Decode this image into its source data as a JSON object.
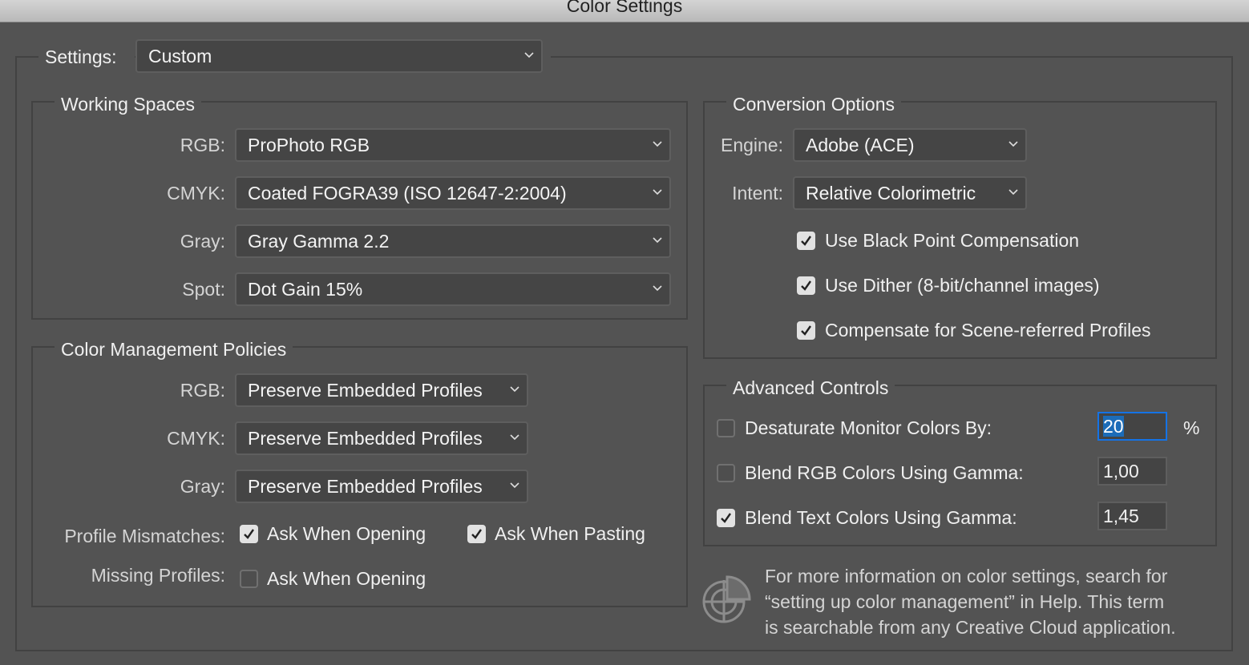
{
  "window": {
    "title": "Color Settings"
  },
  "settings": {
    "label": "Settings:",
    "value": "Custom"
  },
  "working_spaces": {
    "title": "Working Spaces",
    "rows": [
      {
        "label": "RGB:",
        "value": "ProPhoto RGB"
      },
      {
        "label": "CMYK:",
        "value": "Coated FOGRA39 (ISO 12647-2:2004)"
      },
      {
        "label": "Gray:",
        "value": "Gray Gamma 2.2"
      },
      {
        "label": "Spot:",
        "value": "Dot Gain 15%"
      }
    ]
  },
  "policies": {
    "title": "Color Management Policies",
    "rows": [
      {
        "label": "RGB:",
        "value": "Preserve Embedded Profiles"
      },
      {
        "label": "CMYK:",
        "value": "Preserve Embedded Profiles"
      },
      {
        "label": "Gray:",
        "value": "Preserve Embedded Profiles"
      }
    ],
    "mismatch_label": "Profile Mismatches:",
    "ask_opening": {
      "label": "Ask When Opening",
      "checked": true
    },
    "ask_pasting": {
      "label": "Ask When Pasting",
      "checked": true
    },
    "missing_label": "Missing Profiles:",
    "missing_ask_opening": {
      "label": "Ask When Opening",
      "checked": false
    }
  },
  "conversion": {
    "title": "Conversion Options",
    "engine": {
      "label": "Engine:",
      "value": "Adobe (ACE)"
    },
    "intent": {
      "label": "Intent:",
      "value": "Relative Colorimetric"
    },
    "checks": [
      {
        "label": "Use Black Point Compensation",
        "checked": true
      },
      {
        "label": "Use Dither (8-bit/channel images)",
        "checked": true
      },
      {
        "label": "Compensate for Scene-referred Profiles",
        "checked": true
      }
    ]
  },
  "advanced": {
    "title": "Advanced Controls",
    "rows": [
      {
        "label": "Desaturate Monitor Colors By:",
        "checked": false,
        "value": "20",
        "unit": "%"
      },
      {
        "label": "Blend RGB Colors Using Gamma:",
        "checked": false,
        "value": "1,00"
      },
      {
        "label": "Blend Text Colors Using Gamma:",
        "checked": true,
        "value": "1,45"
      }
    ]
  },
  "info": {
    "icon": "color-management-icon",
    "lines": [
      "For more information on color settings, search for",
      "“setting up color management” in Help. This term",
      "is searchable from any Creative Cloud application."
    ]
  },
  "colors": {
    "background": "#535353",
    "focus": "#1473e6"
  }
}
